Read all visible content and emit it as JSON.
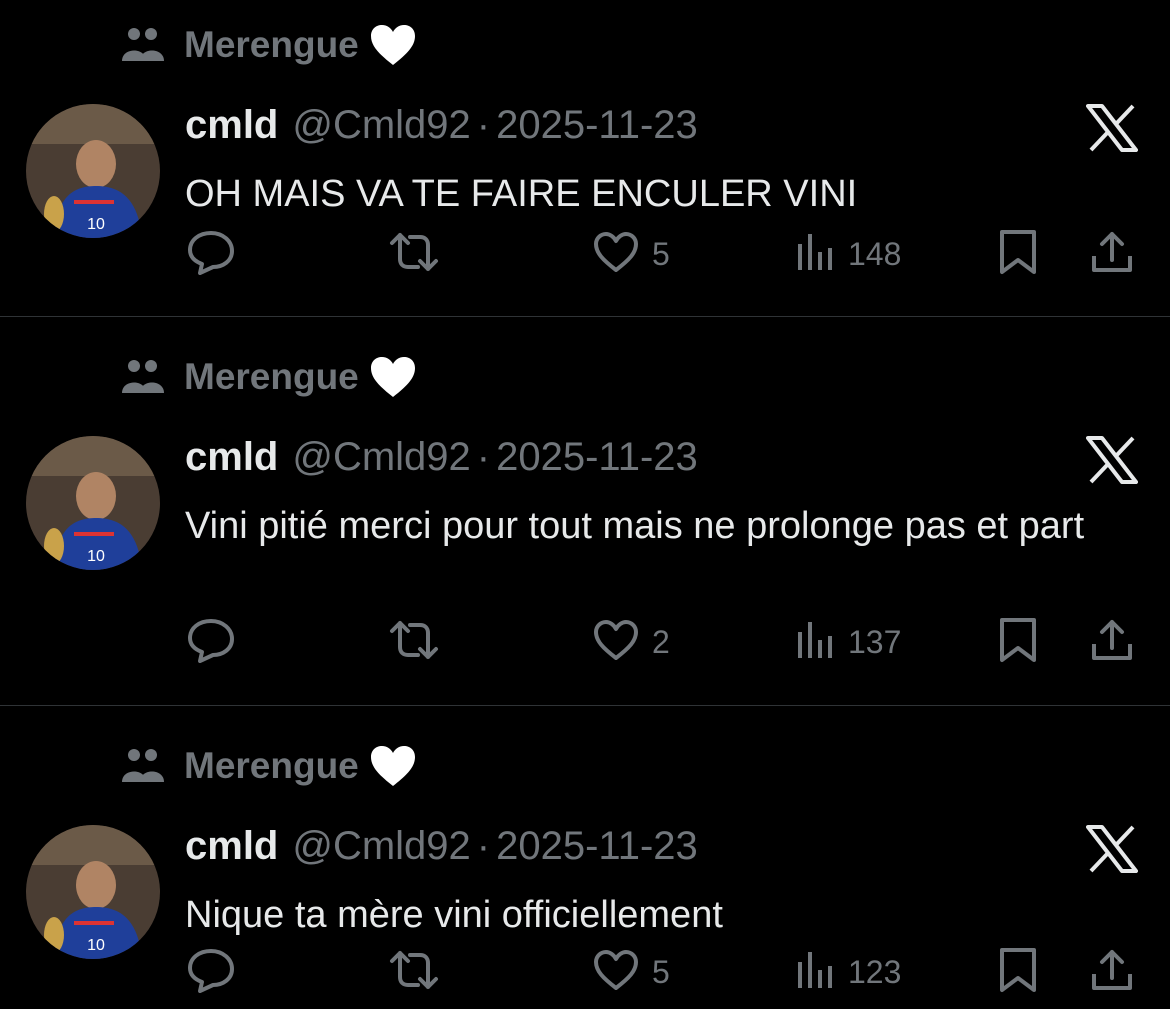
{
  "tweets": [
    {
      "community": "Merengue",
      "name": "cmld",
      "handle": "@Cmld92",
      "separator": "·",
      "date": "2025-11-23",
      "text": "OH MAIS VA TE FAIRE ENCULER VINI",
      "likes": "5",
      "views": "148"
    },
    {
      "community": "Merengue",
      "name": "cmld",
      "handle": "@Cmld92",
      "separator": "·",
      "date": "2025-11-23",
      "text": "Vini pitié merci pour tout mais ne prolonge pas et part",
      "likes": "2",
      "views": "137"
    },
    {
      "community": "Merengue",
      "name": "cmld",
      "handle": "@Cmld92",
      "separator": "·",
      "date": "2025-11-23",
      "text": "Nique ta mère vini officiellement",
      "likes": "5",
      "views": "123"
    }
  ],
  "icons": {
    "community": "community-people-icon",
    "heart_emoji": "white-heart-icon",
    "platform": "x-logo-icon",
    "reply": "reply-icon",
    "repost": "repost-icon",
    "like": "like-heart-icon",
    "views": "views-bar-chart-icon",
    "bookmark": "bookmark-icon",
    "share": "share-icon"
  },
  "colors": {
    "background": "#000000",
    "primary_text": "#e7e9ea",
    "secondary_text": "#71767b",
    "divider": "#2f3336"
  }
}
